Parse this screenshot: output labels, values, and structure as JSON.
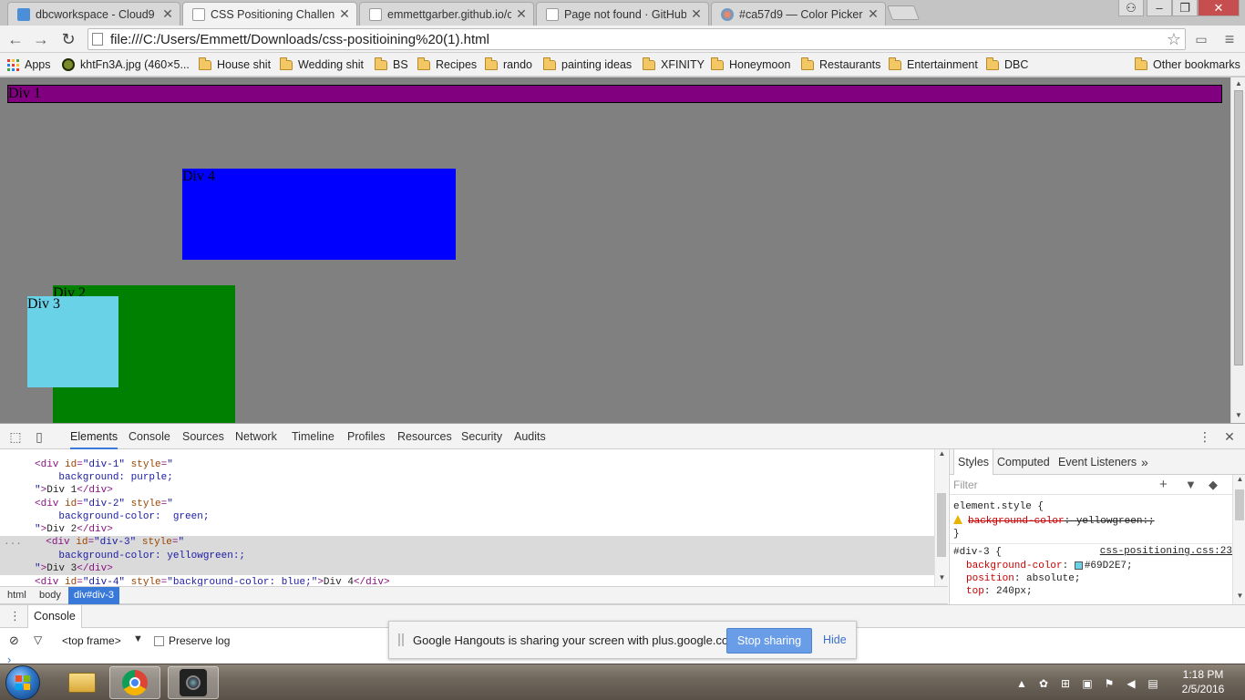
{
  "browser": {
    "tabs": [
      {
        "title": "dbcworkspace - Cloud9",
        "active": false
      },
      {
        "title": "CSS Positioning Challenge",
        "active": true
      },
      {
        "title": "emmettgarber.github.io/c",
        "active": false
      },
      {
        "title": "Page not found · GitHub P",
        "active": false
      },
      {
        "title": "#ca57d9 — Color Picker",
        "active": false
      }
    ],
    "url": "file:///C:/Users/Emmett/Downloads/css-positioining%20(1).html",
    "bookmarks": [
      "Apps",
      "khtFn3A.jpg (460×5...",
      "House shit",
      "Wedding shit",
      "BS",
      "Recipes",
      "rando",
      "painting ideas",
      "XFINITY",
      "Honeymoon",
      "Restaurants",
      "Entertainment",
      "DBC"
    ],
    "other_bookmarks": "Other bookmarks"
  },
  "page": {
    "background": "#808080",
    "divs": [
      {
        "label": "Div 1",
        "color": "#800080"
      },
      {
        "label": "Div 2",
        "color": "#008000"
      },
      {
        "label": "Div 3",
        "color": "#69D2E7"
      },
      {
        "label": "Div 4",
        "color": "#0000FF"
      }
    ]
  },
  "devtools": {
    "tabs": [
      "Elements",
      "Console",
      "Sources",
      "Network",
      "Timeline",
      "Profiles",
      "Resources",
      "Security",
      "Audits"
    ],
    "active_tab": "Elements",
    "code": {
      "l1_tag_open": "<div ",
      "l1_attr": "id",
      "l1_val": "\"div-1\"",
      "l1_attr2": "style",
      "l1_val2": "\"",
      "l2": "    background: purple;",
      "l3_val": "\"",
      "l3_text": "Div 1",
      "l3_close": "</div>",
      "l4_val": "\"div-2\"",
      "l5": "    background-color:  green;",
      "l6_text": "Div 2",
      "l7_val": "\"div-3\"",
      "l8": "    background-color: yellowgreen:;",
      "l9_text": "Div 3",
      "l10_val": "\"div-4\"",
      "l10_style": "\"background-color: blue;\"",
      "l10_text": "Div 4",
      "ellipsis": "...",
      "tag_lt": "<",
      "tag_gt": ">",
      "eq": "=",
      "div": "div"
    },
    "breadcrumbs": [
      "html",
      "body",
      "div#div-3"
    ],
    "styles": {
      "tabs": [
        "Styles",
        "Computed",
        "Event Listeners",
        "»"
      ],
      "filter_placeholder": "Filter",
      "element_style_open": "element.style {",
      "disabled_prop": "background-color",
      "disabled_val": ": yellowgreen:;",
      "close_brace": "}",
      "rule_selector": "#div-3 {",
      "rule_source": "css-positioning.css:23",
      "p1_name": "background-color",
      "p1_val": "#69D2E7;",
      "p2_name": "position",
      "p2_val": "absolute;",
      "p3_name": "top",
      "p3_val": "240px;",
      "colon": ": "
    },
    "drawer": {
      "tab": "Console",
      "frame": "<top frame>",
      "preserve_log": "Preserve log",
      "prompt": "›"
    }
  },
  "hangouts": {
    "message": "Google Hangouts is sharing your screen with plus.google.com.",
    "stop_label": "Stop sharing",
    "hide_label": "Hide"
  },
  "taskbar": {
    "time": "1:18 PM",
    "date": "2/5/2016"
  }
}
